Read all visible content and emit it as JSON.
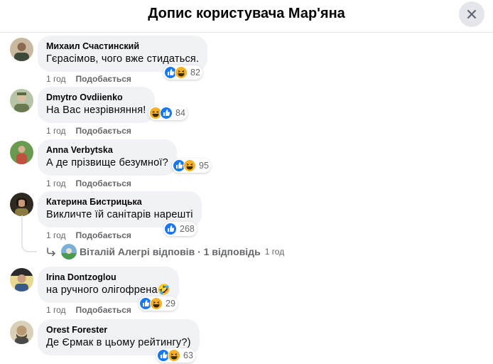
{
  "header": {
    "title": "Допис користувача Мар'яна"
  },
  "actions": {
    "like_label": "Подобається"
  },
  "comments": [
    {
      "author": "Михаил Счастинский",
      "text": "Гєрасімов, чого вже стидаться.",
      "time": "1 год",
      "reaction_count": "82",
      "reactions": [
        "like",
        "haha"
      ]
    },
    {
      "author": "Dmytro Ovdiienko",
      "text": "На Вас незрівняння!",
      "time": "1 год",
      "reaction_count": "84",
      "reactions": [
        "haha",
        "like"
      ]
    },
    {
      "author": "Anna Verbytska",
      "text": "А де прізвище безумної?",
      "time": "1 год",
      "reaction_count": "95",
      "reactions": [
        "like",
        "haha"
      ]
    },
    {
      "author": "Катерина Бистрицька",
      "text": "Викличте їй санітарів нарешті",
      "time": "1 год",
      "reaction_count": "268",
      "reactions": [
        "like"
      ]
    },
    {
      "author": "Irina Dontzoglou",
      "text": "на ручного олігофрена🤣",
      "time": "1 год",
      "reaction_count": "29",
      "reactions": [
        "like",
        "haha"
      ]
    },
    {
      "author": "Orest Forester",
      "text": "Де Єрмак в цьому рейтингу?)",
      "time": "",
      "reaction_count": "63",
      "reactions": [
        "like",
        "haha"
      ]
    }
  ],
  "replies": {
    "text": "Віталій Алегрі відповів · 1 відповідь",
    "time": "1 год"
  },
  "colors": {
    "like": "#1877f2",
    "haha": "#f7b125",
    "meta": "#65676b",
    "bubble": "#f0f2f5"
  }
}
